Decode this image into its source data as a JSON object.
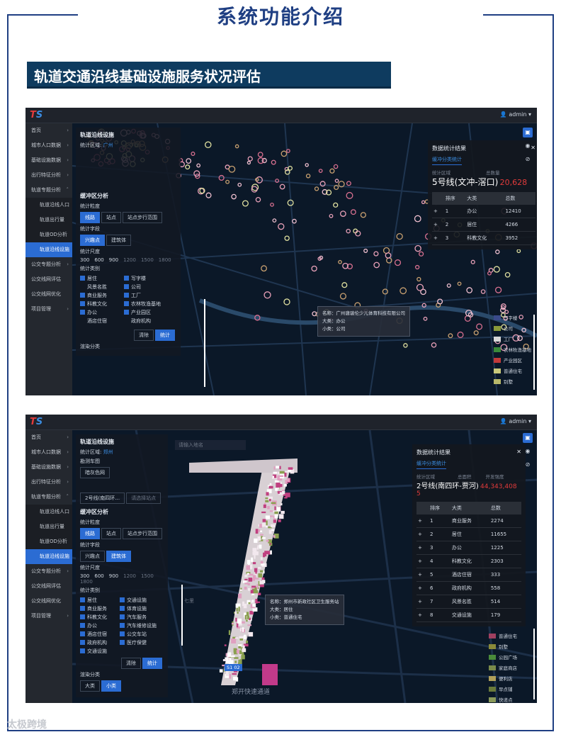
{
  "page_title": "系统功能介绍",
  "section_title": "轨道交通沿线基础设施服务状况评估",
  "watermark": "太极跨境",
  "screens": [
    {
      "user": "admin",
      "sidebar": [
        "首页",
        "城市人口数据",
        "基础设施数据",
        "出行特征分析",
        "轨道专题分析",
        "轨道沿线人口",
        "轨道出行量",
        "轨道OD分析",
        "轨道沿线设施",
        "公交专题分析",
        "公交线网评估",
        "公交线网优化",
        "项目管理"
      ],
      "panel": {
        "title": "轨道沿线设施",
        "stat_area_label": "统计区域",
        "stat_area_value": "广州",
        "buffer_title": "缓冲区分析",
        "stat_dim": "统计粒度",
        "dims": [
          "线路",
          "站点",
          "站点步行范围"
        ],
        "field": "统计字段",
        "fields": [
          "兴趣点",
          "建筑体"
        ],
        "scale_label": "统计尺度",
        "scales": [
          "300",
          "600",
          "900",
          "1200",
          "1500",
          "1800"
        ],
        "cat_label": "统计类别",
        "cats": [
          "居住",
          "写字楼",
          "风景名胜",
          "公司",
          "商业服务",
          "工厂",
          "科教文化",
          "农林牧渔基地",
          "办公",
          "产业园区",
          "酒店住宿",
          "政府机构"
        ],
        "btn_clear": "清除",
        "btn_stat": "统计",
        "render": "渲染分类"
      },
      "stat": {
        "title": "数据统计结果",
        "tab": "缓冲分类统计",
        "area_label": "统计区域",
        "total_label": "总数量",
        "area": "5号线(文冲-滘口)",
        "total": "20,628",
        "headers": [
          "排序",
          "大类",
          "总数"
        ],
        "rows": [
          [
            "1",
            "办公",
            "12410"
          ],
          [
            "2",
            "居住",
            "4266"
          ],
          [
            "3",
            "科教文化",
            "3952"
          ]
        ]
      },
      "tooltip": [
        "名称：广州唐骏伦少儿体育科技有限公司",
        "大类：办公",
        "小类：公司"
      ],
      "legend": [
        {
          "name": "写字楼",
          "color": "#3a4a8a"
        },
        {
          "name": "公司",
          "color": "#8a9a3a"
        },
        {
          "name": "工厂",
          "color": "#d8d8d8"
        },
        {
          "name": "农林牧渔基地",
          "color": "#3a8a3a"
        },
        {
          "name": "产业园区",
          "color": "#c23a3a"
        },
        {
          "name": "普通住宅",
          "color": "#c8c87a"
        },
        {
          "name": "别墅",
          "color": "#b8b86a"
        }
      ]
    },
    {
      "user": "admin",
      "search_placeholder": "请输入地名",
      "sidebar": [
        "首页",
        "城市人口数据",
        "基础设施数据",
        "出行特征分析",
        "轨道专题分析",
        "轨道沿线人口",
        "轨道出行量",
        "轨道OD分析",
        "轨道沿线设施",
        "公交专题分析",
        "公交线网评估",
        "公交线网优化",
        "项目管理"
      ],
      "panel": {
        "title": "轨道沿线设施",
        "stat_area_label": "统计区域",
        "stat_area_value": "郑州",
        "bg_map_label": "勘测车图",
        "bg_map_value": "暗灰色网",
        "line_select": "2号线(南四环…",
        "station_placeholder": "请选择站点",
        "buffer_title": "缓冲区分析",
        "stat_dim": "统计粒度",
        "dims": [
          "线路",
          "站点",
          "站点步行范围"
        ],
        "field": "统计字段",
        "fields": [
          "兴趣点",
          "建筑体"
        ],
        "scale_label": "统计尺度",
        "scales": [
          "300",
          "600",
          "900",
          "1200",
          "1500",
          "1800"
        ],
        "cat_label": "统计类别",
        "cats": [
          "居住",
          "交通设施",
          "商业服务",
          "体育设施",
          "科教文化",
          "汽车服务",
          "办公",
          "汽车维修设施",
          "酒店住宿",
          "公交车站",
          "政府机构",
          "医疗保健",
          "交通设施"
        ],
        "btn_clear": "清除",
        "btn_stat": "统计",
        "render": "渲染分类",
        "render_opts": [
          "大类",
          "小类"
        ]
      },
      "stat": {
        "title": "数据统计结果",
        "tab": "缓冲分类统计",
        "area_label": "统计区域",
        "total_label": "总面积",
        "extra_label": "开发强度",
        "area": "2号线(南四环-贾河)",
        "total": "44,343,408",
        "extra": "5",
        "headers": [
          "排序",
          "大类",
          "总数"
        ],
        "rows": [
          [
            "1",
            "商业服务",
            "2274"
          ],
          [
            "2",
            "居住",
            "11655"
          ],
          [
            "3",
            "办公",
            "1225"
          ],
          [
            "4",
            "科教文化",
            "2303"
          ],
          [
            "5",
            "酒店住宿",
            "333"
          ],
          [
            "6",
            "政府机构",
            "558"
          ],
          [
            "7",
            "风景名胜",
            "514"
          ],
          [
            "8",
            "交通设施",
            "179"
          ]
        ]
      },
      "tooltip": [
        "名称：郑州市新政社区卫生服务站",
        "大类：居住",
        "小类：普通住宅"
      ],
      "labels": [
        "郑开快速通道",
        "S1 02",
        "七里"
      ],
      "legend": [
        {
          "name": "普通住宅",
          "color": "#a04060"
        },
        {
          "name": "别墅",
          "color": "#8a8a3a"
        },
        {
          "name": "公园广场",
          "color": "#4a8a3a"
        },
        {
          "name": "家庭商店",
          "color": "#7a8a4a"
        },
        {
          "name": "便利店",
          "color": "#b0a05a"
        },
        {
          "name": "早点铺",
          "color": "#6a7a3a"
        },
        {
          "name": "快递点",
          "color": "#8a9a5a"
        }
      ]
    }
  ]
}
